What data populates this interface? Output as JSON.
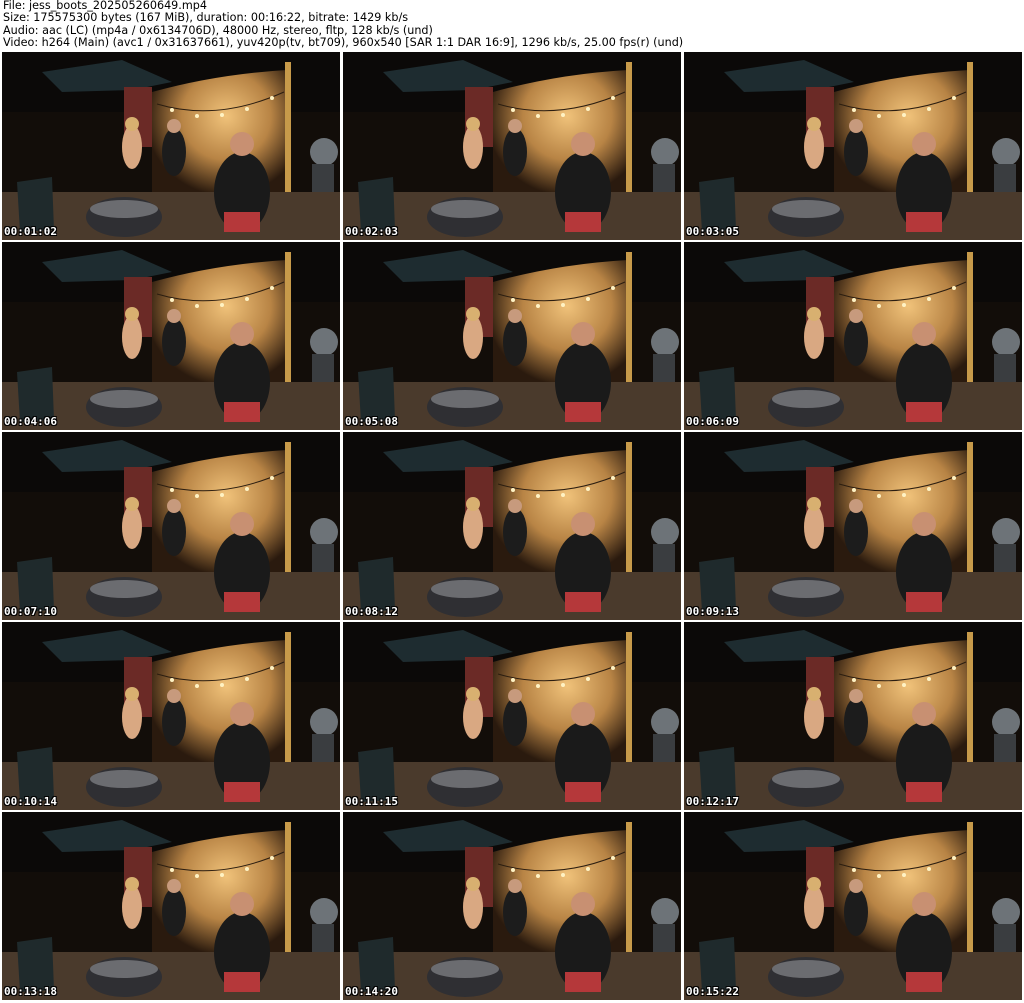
{
  "header": {
    "line1": "File: jess_boots_202505260649.mp4",
    "line2": "Size: 175575300 bytes (167 MiB), duration: 00:16:22, bitrate: 1429 kb/s",
    "line3": "Audio: aac (LC) (mp4a / 0x6134706D), 48000 Hz, stereo, fltp, 128 kb/s (und)",
    "line4": "Video: h264 (Main) (avc1 / 0x31637661), yuv420p(tv, bt709), 960x540 [SAR 1:1 DAR 16:9], 1296 kb/s, 25.00 fps(r) (und)"
  },
  "thumbnails": [
    {
      "timestamp": "00:01:02"
    },
    {
      "timestamp": "00:02:03"
    },
    {
      "timestamp": "00:03:05"
    },
    {
      "timestamp": "00:04:06"
    },
    {
      "timestamp": "00:05:08"
    },
    {
      "timestamp": "00:06:09"
    },
    {
      "timestamp": "00:07:10"
    },
    {
      "timestamp": "00:08:12"
    },
    {
      "timestamp": "00:09:13"
    },
    {
      "timestamp": "00:10:14"
    },
    {
      "timestamp": "00:11:15"
    },
    {
      "timestamp": "00:12:17"
    },
    {
      "timestamp": "00:13:18"
    },
    {
      "timestamp": "00:14:20"
    },
    {
      "timestamp": "00:15:22"
    }
  ]
}
